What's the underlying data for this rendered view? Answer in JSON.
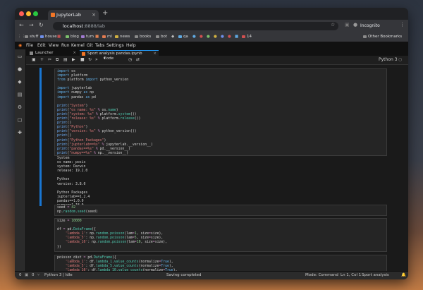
{
  "browser": {
    "tab_title": "JupyterLab",
    "new_tab": "+",
    "url_host": "localhost",
    "url_path": ":8888/lab",
    "incognito_label": "Incognito",
    "bookmarks": [
      {
        "label": "stuff",
        "color": "#8a8a8a"
      },
      {
        "label": "house",
        "color": "#6e8ee8"
      },
      {
        "label": "blog",
        "color": "#7cc06c"
      },
      {
        "label": "tum",
        "color": "#a07ad0"
      },
      {
        "label": "ml",
        "color": "#e07a50"
      },
      {
        "label": "news",
        "color": "#d0b040"
      },
      {
        "label": "books",
        "color": "#8a8a8a"
      },
      {
        "label": "bot",
        "color": "#8a8a8a"
      },
      {
        "label": "qa",
        "color": "#5fa8e0"
      },
      {
        "label": "14",
        "color": "#d05050"
      }
    ],
    "other_bookmarks": "Other Bookmarks"
  },
  "menu": [
    "File",
    "Edit",
    "View",
    "Run",
    "Kernel",
    "Git",
    "Tabs",
    "Settings",
    "Help"
  ],
  "doc_tabs": [
    {
      "label": "Launcher",
      "active": false
    },
    {
      "label": "Sport analysis pandas.ipynb",
      "active": true
    }
  ],
  "toolbar": {
    "cell_type": "Code",
    "kernel": "Python 3"
  },
  "cells": {
    "c1": {
      "prompt": "[1]:"
    },
    "c3": {
      "prompt": "[3]:"
    },
    "c18": {
      "prompt": "[18]:"
    },
    "c20": {
      "prompt": "[20]:"
    }
  },
  "status": {
    "left_count": "0",
    "kernel": "Python 3 | Idle",
    "saving": "Saving completed",
    "mode": "Mode: Command",
    "position": "Ln 1, Col 1",
    "file": "Sport analysis pandas.ipynb"
  },
  "colors": {
    "accent": "#2196f3",
    "collapser": "#1976d2",
    "jupyter": "#f37626"
  },
  "icons": [
    "back-icon",
    "forward-icon",
    "reload-icon",
    "star-icon",
    "folder-icon",
    "running-icon",
    "git-icon",
    "commands-icon",
    "property-inspector-icon",
    "tabs-icon",
    "extension-icon"
  ]
}
